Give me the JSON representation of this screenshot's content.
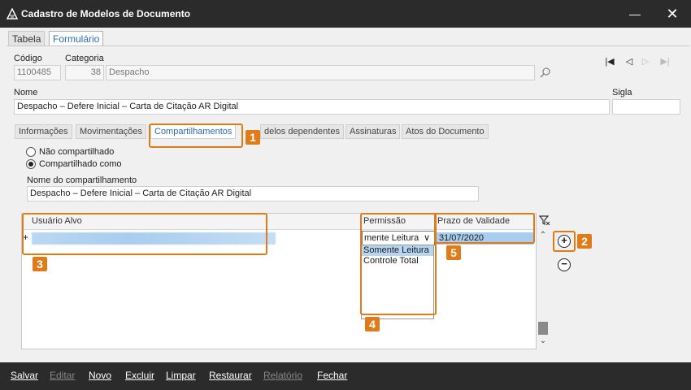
{
  "window": {
    "title": "Cadastro de Modelos de Documento"
  },
  "main_tabs": [
    {
      "label": "Tabela"
    },
    {
      "label": "Formulário"
    }
  ],
  "form": {
    "codigo_label": "Código",
    "codigo_value": "1100485",
    "categoria_label": "Categoria",
    "categoria_num": "38",
    "categoria_value": "Despacho",
    "nome_label": "Nome",
    "nome_value": "Despacho – Defere Inicial – Carta de Citação AR Digital",
    "sigla_label": "Sigla",
    "sigla_value": ""
  },
  "sub_tabs": [
    {
      "label": "Informações"
    },
    {
      "label": "Movimentações"
    },
    {
      "label": "Compartilhamentos"
    },
    {
      "label": "delos dependentes"
    },
    {
      "label": "Assinaturas"
    },
    {
      "label": "Atos do Documento"
    }
  ],
  "sharing": {
    "option_none": "Não compartilhado",
    "option_shared": "Compartilhado como",
    "name_label": "Nome do compartilhamento",
    "name_value": "Despacho – Defere Inicial – Carta de Citação AR Digital"
  },
  "grid": {
    "columns": [
      "Usuário Alvo",
      "Permissão",
      "Prazo de Validade"
    ],
    "row_marker": "+",
    "permission_combo_value": "mente Leitura",
    "date_value": "31/07/2020",
    "permission_options": [
      "Somente Leitura",
      "Controle Total"
    ]
  },
  "badges": [
    "1",
    "2",
    "3",
    "4",
    "5"
  ],
  "highlight_color": "#e07b1a",
  "bottom_bar": [
    {
      "label": "Salvar",
      "enabled": true
    },
    {
      "label": "Editar",
      "enabled": false
    },
    {
      "label": "Novo",
      "enabled": true
    },
    {
      "label": "Excluir",
      "enabled": true
    },
    {
      "label": "Limpar",
      "enabled": true
    },
    {
      "label": "Restaurar",
      "enabled": true
    },
    {
      "label": "Relatório",
      "enabled": false
    },
    {
      "label": "Fechar",
      "enabled": true
    }
  ]
}
